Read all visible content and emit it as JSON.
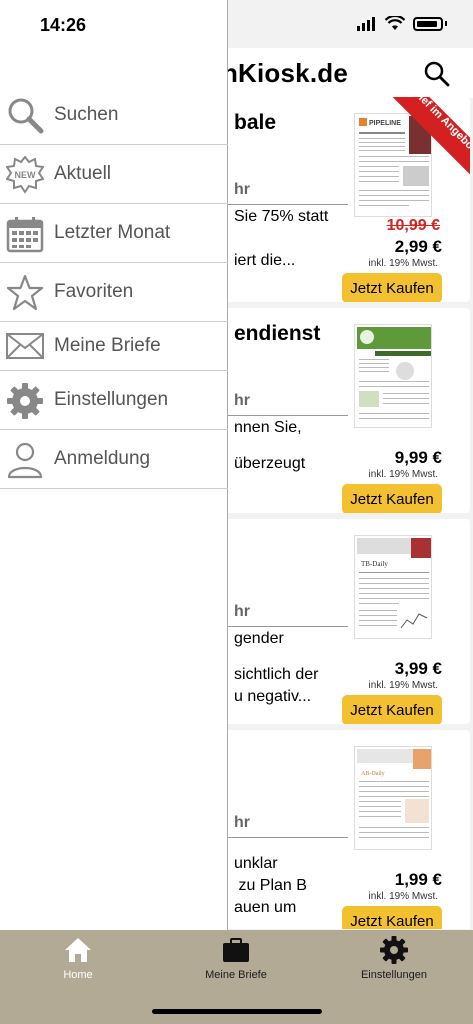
{
  "status": {
    "time": "14:26"
  },
  "header": {
    "brand": "nKiosk.de"
  },
  "cards": [
    {
      "title": "bale",
      "meta": "hr",
      "desc": "Sie 75% statt\n\niert die...",
      "price_old": "10,99 €",
      "price": "2,99 €",
      "tax": "inkl. 19% Mwst.",
      "buy": "Jetzt Kaufen",
      "ribbon": "Brief im Angebot"
    },
    {
      "title": "endienst",
      "meta": "hr",
      "desc": "nnen Sie,\n\nüberzeugt",
      "price_old": "",
      "price": "9,99 €",
      "tax": "inkl. 19% Mwst.",
      "buy": "Jetzt Kaufen",
      "ribbon": ""
    },
    {
      "title": "",
      "meta": "hr",
      "desc": "gender\n\nsichtlich der\nu negativ...",
      "price_old": "",
      "price": "3,99 €",
      "tax": "inkl. 19% Mwst.",
      "buy": "Jetzt Kaufen",
      "ribbon": ""
    },
    {
      "title": "",
      "meta": "hr",
      "desc": "unklar\n zu Plan B\nauen um",
      "price_old": "",
      "price": "1,99 €",
      "tax": "inkl. 19% Mwst.",
      "buy": "Jetzt Kaufen",
      "ribbon": ""
    }
  ],
  "menu": {
    "items": [
      {
        "label": "Suchen",
        "icon": "magnifier-icon"
      },
      {
        "label": "Aktuell",
        "icon": "new-badge-icon"
      },
      {
        "label": "Letzter Monat",
        "icon": "calendar-icon"
      },
      {
        "label": "Favoriten",
        "icon": "star-icon"
      },
      {
        "label": "Meine Briefe",
        "icon": "envelope-icon"
      },
      {
        "label": "Einstellungen",
        "icon": "gear-icon"
      },
      {
        "label": "Anmeldung",
        "icon": "person-icon"
      }
    ]
  },
  "tabbar": {
    "items": [
      {
        "label": "Home",
        "icon": "home-icon",
        "active": true
      },
      {
        "label": "Meine Briefe",
        "icon": "briefcase-icon",
        "active": false
      },
      {
        "label": "Einstellungen",
        "icon": "gear-icon",
        "active": false
      }
    ]
  },
  "colors": {
    "buy": "#f3c02f",
    "tabbar": "#b3aa95",
    "ribbon": "#d42020",
    "strike": "#d92121"
  }
}
